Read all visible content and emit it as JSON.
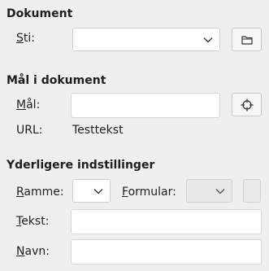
{
  "document_section": {
    "title": "Dokument",
    "path_label_first": "S",
    "path_label_rest": "ti:",
    "path_value": "",
    "browse_icon": "folder-icon"
  },
  "target_section": {
    "title": "Mål i dokument",
    "target_label_first": "M",
    "target_label_rest": "ål:",
    "target_value": "",
    "target_icon": "crosshair-icon",
    "url_label": "URL:",
    "url_value": "Testtekst"
  },
  "further_section": {
    "title": "Yderligere indstillinger",
    "frame_label_first": "R",
    "frame_label_rest": "amme:",
    "frame_value": "",
    "form_label_first": "F",
    "form_label_rest": "ormular:",
    "form_value": "",
    "text_label_first": "T",
    "text_label_rest": "ekst:",
    "text_value": "",
    "name_label_first": "N",
    "name_label_rest": "avn:",
    "name_value": ""
  }
}
